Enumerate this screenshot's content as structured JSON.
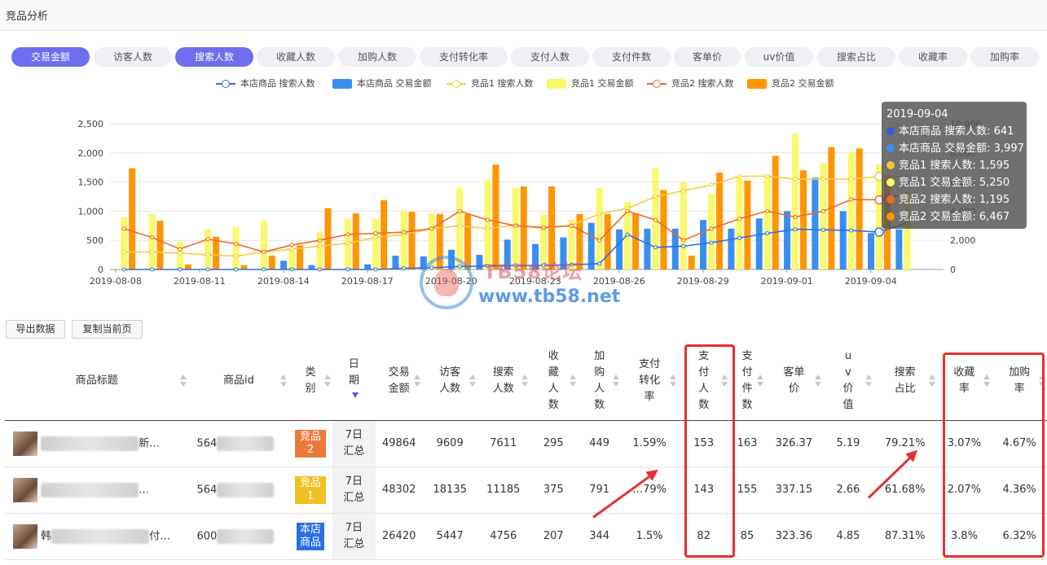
{
  "page": {
    "title": "竞品分析"
  },
  "tabs": [
    {
      "label": "交易金额",
      "active": true
    },
    {
      "label": "访客人数",
      "active": false
    },
    {
      "label": "搜索人数",
      "active": true
    },
    {
      "label": "收藏人数",
      "active": false
    },
    {
      "label": "加购人数",
      "active": false
    },
    {
      "label": "支付转化率",
      "active": false
    },
    {
      "label": "支付人数",
      "active": false
    },
    {
      "label": "支付件数",
      "active": false
    },
    {
      "label": "客单价",
      "active": false
    },
    {
      "label": "uv价值",
      "active": false
    },
    {
      "label": "搜索占比",
      "active": false
    },
    {
      "label": "收藏率",
      "active": false
    },
    {
      "label": "加购率",
      "active": false
    }
  ],
  "legend": [
    {
      "label": "本店商品 搜索人数",
      "kind": "line",
      "color": "#2e6fe0"
    },
    {
      "label": "本店商品 交易金额",
      "kind": "bar",
      "color": "#3a8ef0"
    },
    {
      "label": "竞品1 搜索人数",
      "kind": "line",
      "color": "#f0d040"
    },
    {
      "label": "竞品1 交易金额",
      "kind": "bar",
      "color": "#fbf86a"
    },
    {
      "label": "竞品2 搜索人数",
      "kind": "line",
      "color": "#ec6a2a"
    },
    {
      "label": "竞品2 交易金额",
      "kind": "bar",
      "color": "#ff9500"
    }
  ],
  "chart_data": {
    "type": "bar",
    "x": [
      "2019-08-08",
      "2019-08-09",
      "2019-08-10",
      "2019-08-11",
      "2019-08-12",
      "2019-08-13",
      "2019-08-14",
      "2019-08-15",
      "2019-08-16",
      "2019-08-17",
      "2019-08-18",
      "2019-08-19",
      "2019-08-20",
      "2019-08-21",
      "2019-08-22",
      "2019-08-23",
      "2019-08-24",
      "2019-08-25",
      "2019-08-26",
      "2019-08-27",
      "2019-08-28",
      "2019-08-29",
      "2019-08-30",
      "2019-08-31",
      "2019-09-01",
      "2019-09-02",
      "2019-09-03",
      "2019-09-04",
      "2019-09-05",
      "2019-09-06"
    ],
    "x_tick_labels": [
      "2019-08-08",
      "2019-08-11",
      "2019-08-14",
      "2019-08-17",
      "2019-08-20",
      "2019-08-23",
      "2019-08-26",
      "2019-08-29",
      "2019-09-01",
      "2019-09-04"
    ],
    "left_axis": {
      "ylim": [
        0,
        2500
      ],
      "ticks": [
        "0",
        "500",
        "1,000",
        "1,500",
        "2,000",
        "2,500"
      ]
    },
    "right_axis": {
      "ylim": [
        0,
        10000
      ],
      "ticks": [
        "0",
        "2,000",
        "4,000",
        "6,000",
        "8,000",
        "10,000"
      ]
    },
    "grid": true,
    "series": [
      {
        "name": "本店商品 交易金额",
        "kind": "bar",
        "axis": "right",
        "values": [
          0,
          0,
          0,
          0,
          0,
          0,
          600,
          300,
          0,
          350,
          950,
          900,
          1350,
          1000,
          2050,
          1750,
          2200,
          3200,
          2750,
          2800,
          2800,
          3400,
          2800,
          3500,
          4000,
          6300,
          4000,
          2500,
          2750,
          0
        ]
      },
      {
        "name": "竞品1 交易金额",
        "kind": "bar",
        "axis": "right",
        "values": [
          3600,
          3800,
          1900,
          2750,
          2900,
          3350,
          1450,
          2550,
          3450,
          3450,
          4050,
          3850,
          5600,
          6150,
          5600,
          3750,
          3400,
          5600,
          4650,
          6950,
          6000,
          5200,
          6300,
          6500,
          9300,
          7300,
          8050,
          7200,
          5250,
          0
        ]
      },
      {
        "name": "竞品2 交易金额",
        "kind": "bar",
        "axis": "right",
        "values": [
          6950,
          3350,
          350,
          2250,
          300,
          950,
          1650,
          4200,
          3850,
          4750,
          3950,
          3800,
          3800,
          7200,
          5700,
          5700,
          3800,
          3800,
          3850,
          5450,
          950,
          6650,
          6100,
          7800,
          6800,
          8400,
          8300,
          6467,
          0,
          0
        ]
      },
      {
        "name": "本店商品 搜索人数",
        "kind": "line",
        "axis": "left",
        "values": [
          0,
          0,
          0,
          0,
          0,
          0,
          0,
          0,
          0,
          0,
          20,
          30,
          50,
          60,
          70,
          70,
          80,
          100,
          600,
          380,
          400,
          460,
          540,
          620,
          690,
          680,
          670,
          641,
          800,
          0
        ]
      },
      {
        "name": "竞品1 搜索人数",
        "kind": "line",
        "axis": "left",
        "values": [
          300,
          300,
          280,
          250,
          230,
          300,
          350,
          400,
          450,
          550,
          600,
          700,
          750,
          700,
          760,
          700,
          760,
          950,
          1050,
          1250,
          1350,
          1450,
          1600,
          1600,
          1550,
          1550,
          1550,
          1595,
          1600,
          0
        ]
      },
      {
        "name": "竞品2 搜索人数",
        "kind": "line",
        "axis": "left",
        "values": [
          700,
          550,
          350,
          520,
          440,
          300,
          420,
          500,
          600,
          620,
          640,
          700,
          1000,
          850,
          750,
          720,
          750,
          500,
          1000,
          850,
          500,
          700,
          870,
          1000,
          900,
          1000,
          1200,
          1195,
          1300,
          0
        ]
      }
    ]
  },
  "tooltip": {
    "date": "2019-09-04",
    "rows": [
      {
        "text": "本店商品 搜索人数: 641",
        "color": "#2e5fd6"
      },
      {
        "text": "本店商品 交易金额: 3,997",
        "color": "#3a8ef0"
      },
      {
        "text": "竞品1 搜索人数: 1,595",
        "color": "#f0c830"
      },
      {
        "text": "竞品1 交易金额: 5,250",
        "color": "#fbf86a"
      },
      {
        "text": "竞品2 搜索人数: 1,195",
        "color": "#ec6a2a"
      },
      {
        "text": "竞品2 交易金额: 6,467",
        "color": "#ff9500"
      }
    ]
  },
  "watermark": {
    "line1": "TB58论坛",
    "line2": "www.tb58.net"
  },
  "toolbar": {
    "export_label": "导出数据",
    "copy_label": "复制当前页"
  },
  "table": {
    "headers": {
      "title": "商品标题",
      "id": "商品id",
      "category": "类别",
      "date": "日期",
      "amount": "交易金额",
      "visitors": "访客人数",
      "search": "搜索人数",
      "fav": "收藏人数",
      "cart": "加购人数",
      "conv": "支付转化率",
      "paid": "支付人数",
      "pieces": "支付件数",
      "aov": "客单价",
      "uv": "uv价值",
      "share": "搜索占比",
      "favrate": "收藏率",
      "cartrate": "加购率"
    },
    "rows": [
      {
        "title_head": "",
        "title_tail": "新…",
        "id": "564",
        "category": "竞品2",
        "cat_color": "#ec7a3a",
        "date": "7日汇总",
        "amount": "49864",
        "visitors": "9609",
        "search": "7611",
        "fav": "295",
        "cart": "449",
        "conv": "1.59%",
        "paid": "153",
        "pieces": "163",
        "aov": "326.37",
        "uv": "5.19",
        "share": "79.21%",
        "favrate": "3.07%",
        "cartrate": "4.67%"
      },
      {
        "title_head": "",
        "title_tail": "…",
        "id": "564",
        "category": "竞品1",
        "cat_color": "#f0c020",
        "date": "7日汇总",
        "amount": "48302",
        "visitors": "18135",
        "search": "11185",
        "fav": "375",
        "cart": "791",
        "conv": "…79%",
        "paid": "143",
        "pieces": "155",
        "aov": "337.15",
        "uv": "2.66",
        "share": "61.68%",
        "favrate": "2.07%",
        "cartrate": "4.36%"
      },
      {
        "title_head": "韩",
        "title_tail": "付…",
        "id": "600",
        "category": "本店商品",
        "cat_color": "#2a6fe0",
        "date": "7日汇总",
        "amount": "26420",
        "visitors": "5447",
        "search": "4756",
        "fav": "207",
        "cart": "344",
        "conv": "1.5%",
        "paid": "82",
        "pieces": "85",
        "aov": "323.36",
        "uv": "4.85",
        "share": "87.31%",
        "favrate": "3.8%",
        "cartrate": "6.32%"
      }
    ]
  }
}
